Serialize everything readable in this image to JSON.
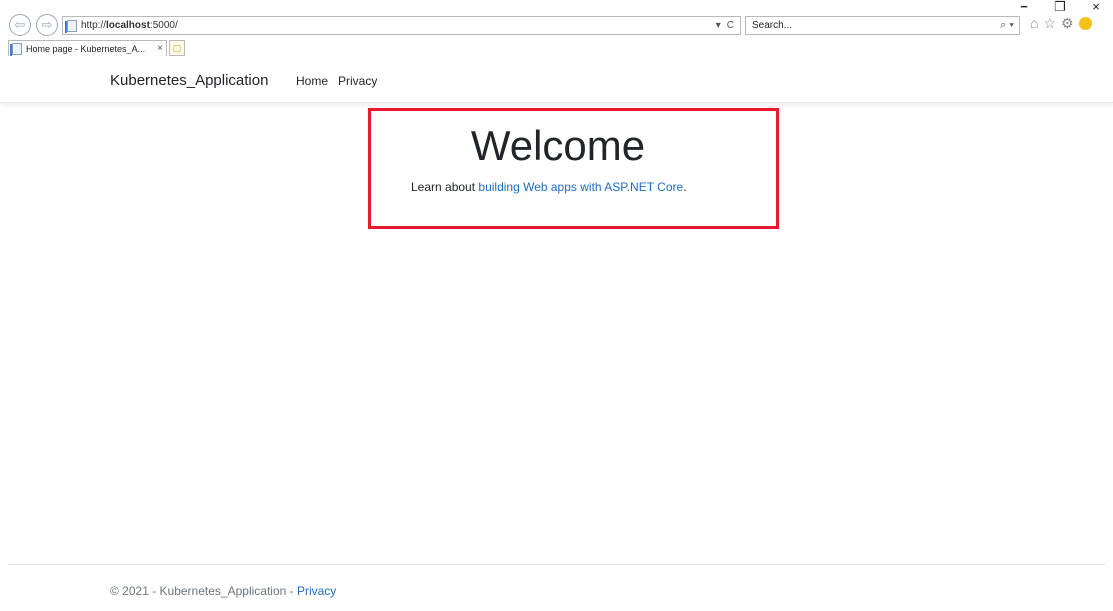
{
  "browser": {
    "address": {
      "prefix": "http://",
      "host": "localhost",
      "rest": ":5000/"
    },
    "address_tools": [
      "▾",
      "C"
    ],
    "search_placeholder": "Search...",
    "search_tools": "⌕ ▾",
    "tab": {
      "title": "Home page - Kubernetes_A...",
      "close": "×"
    },
    "window": {
      "minimize": "−",
      "restore": "❐",
      "close": "×"
    },
    "icons": [
      "home-icon",
      "star-icon",
      "gear-icon",
      "smiley-icon"
    ]
  },
  "navbar": {
    "brand": "Kubernetes_Application",
    "links": [
      "Home",
      "Privacy"
    ]
  },
  "main": {
    "title": "Welcome",
    "learn_prefix": "Learn about ",
    "learn_link": "building Web apps with ASP.NET Core",
    "learn_suffix": "."
  },
  "footer": {
    "text": "© 2021 - Kubernetes_Application - ",
    "link": "Privacy"
  },
  "colors": {
    "link": "#1b6ec2",
    "highlight_box": "#e8192c"
  }
}
